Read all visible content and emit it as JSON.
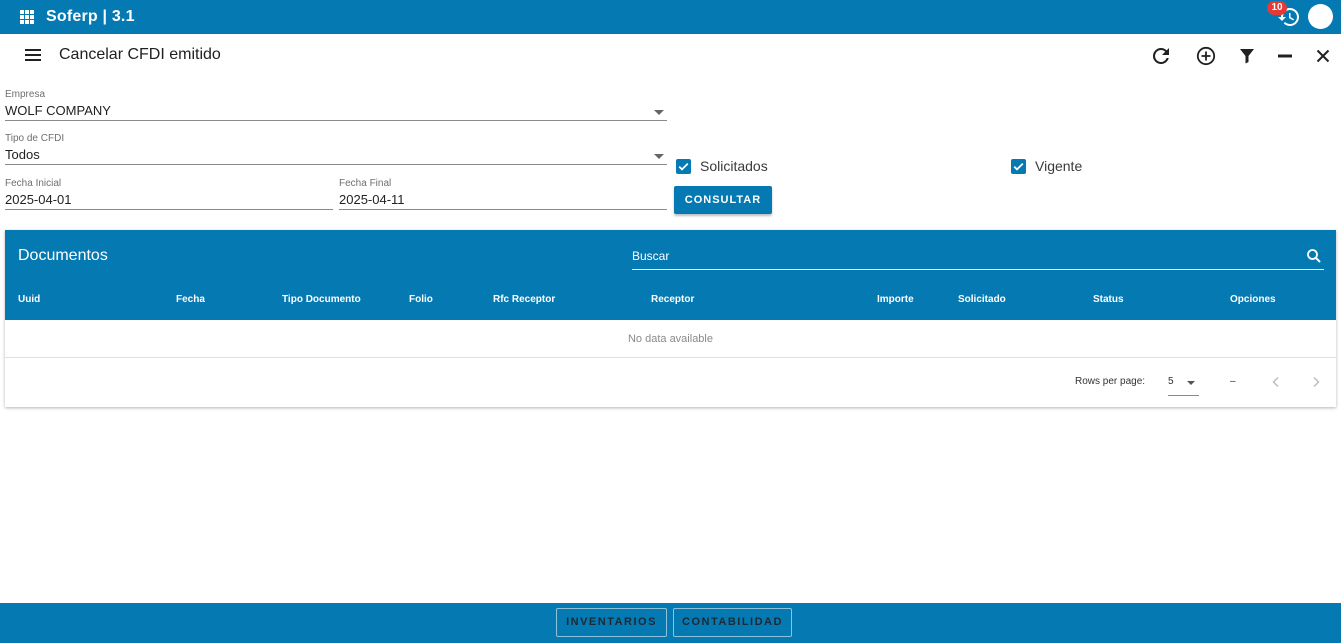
{
  "app": {
    "title": "Soferp | 3.1",
    "notification_count": "10"
  },
  "toolbar": {
    "title": "Cancelar CFDI emitido"
  },
  "form": {
    "empresa": {
      "label": "Empresa",
      "value": "WOLF COMPANY"
    },
    "tipo_cfdi": {
      "label": "Tipo de CFDI",
      "value": "Todos"
    },
    "fecha_inicial": {
      "label": "Fecha Inicial",
      "value": "2025-04-01"
    },
    "fecha_final": {
      "label": "Fecha Final",
      "value": "2025-04-11"
    },
    "solicitados": {
      "label": "Solicitados",
      "checked": true
    },
    "vigente": {
      "label": "Vigente",
      "checked": true
    },
    "consultar_label": "CONSULTAR"
  },
  "table": {
    "title": "Documentos",
    "search_placeholder": "Buscar",
    "columns": [
      "Uuid",
      "Fecha",
      "Tipo Documento",
      "Folio",
      "Rfc Receptor",
      "Receptor",
      "Importe",
      "Solicitado",
      "Status",
      "Opciones"
    ],
    "empty_text": "No data available",
    "rows_per_page_label": "Rows per page:",
    "rows_per_page_value": "5",
    "range_text": "–"
  },
  "bottom": {
    "buttons": [
      "INVENTARIOS",
      "CONTABILIDAD"
    ]
  },
  "colors": {
    "primary": "#0579b2",
    "badge": "#e53935"
  }
}
